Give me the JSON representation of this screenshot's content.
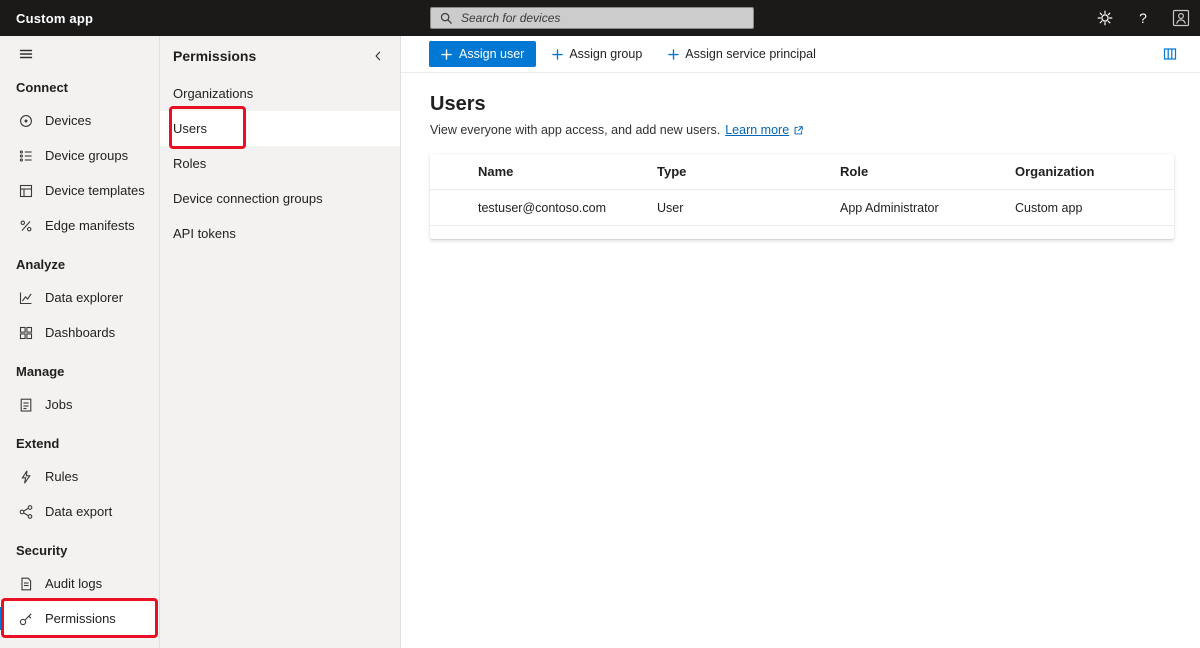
{
  "topbar": {
    "app_title": "Custom app",
    "search_placeholder": "Search for devices",
    "help_label": "?"
  },
  "sidebar": {
    "sections": [
      {
        "label": "Connect",
        "items": [
          {
            "label": "Devices",
            "icon": "devices-icon"
          },
          {
            "label": "Device groups",
            "icon": "device-groups-icon"
          },
          {
            "label": "Device templates",
            "icon": "device-templates-icon"
          },
          {
            "label": "Edge manifests",
            "icon": "edge-manifests-icon"
          }
        ]
      },
      {
        "label": "Analyze",
        "items": [
          {
            "label": "Data explorer",
            "icon": "data-explorer-icon"
          },
          {
            "label": "Dashboards",
            "icon": "dashboards-icon"
          }
        ]
      },
      {
        "label": "Manage",
        "items": [
          {
            "label": "Jobs",
            "icon": "jobs-icon"
          }
        ]
      },
      {
        "label": "Extend",
        "items": [
          {
            "label": "Rules",
            "icon": "rules-icon"
          },
          {
            "label": "Data export",
            "icon": "data-export-icon"
          }
        ]
      },
      {
        "label": "Security",
        "items": [
          {
            "label": "Audit logs",
            "icon": "audit-logs-icon"
          },
          {
            "label": "Permissions",
            "icon": "permissions-icon",
            "selected": true
          }
        ]
      }
    ]
  },
  "panel": {
    "title": "Permissions",
    "items": [
      {
        "label": "Organizations"
      },
      {
        "label": "Users",
        "selected": true
      },
      {
        "label": "Roles"
      },
      {
        "label": "Device connection groups"
      },
      {
        "label": "API tokens"
      }
    ]
  },
  "toolbar": {
    "assign_user_label": "Assign user",
    "assign_group_label": "Assign group",
    "assign_service_principal_label": "Assign service principal"
  },
  "content": {
    "title": "Users",
    "subtitle": "View everyone with app access, and add new users.",
    "learn_more_label": "Learn more"
  },
  "table": {
    "columns": [
      "Name",
      "Type",
      "Role",
      "Organization"
    ],
    "rows": [
      [
        "testuser@contoso.com",
        "User",
        "App Administrator",
        "Custom app"
      ]
    ]
  },
  "colors": {
    "accent": "#0078d4",
    "annotation_red": "#e81123",
    "topbar_bg": "#1b1a19",
    "nav_bg": "#f3f2f1",
    "link_blue": "#0067b8"
  }
}
